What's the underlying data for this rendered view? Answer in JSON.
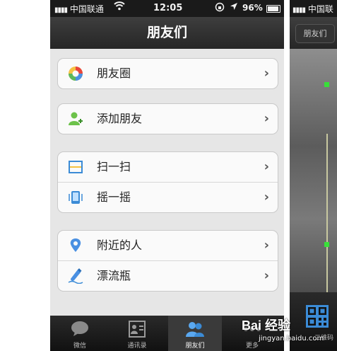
{
  "status_bar": {
    "carrier": "中国联通",
    "time": "12:05",
    "battery_percent": "96%"
  },
  "nav": {
    "title": "朋友们"
  },
  "groups": [
    [
      {
        "label": "朋友圈",
        "icon": "moments-icon"
      }
    ],
    [
      {
        "label": "添加朋友",
        "icon": "add-friend-icon"
      }
    ],
    [
      {
        "label": "扫一扫",
        "icon": "scan-icon"
      },
      {
        "label": "摇一摇",
        "icon": "shake-icon"
      }
    ],
    [
      {
        "label": "附近的人",
        "icon": "location-pin-icon"
      },
      {
        "label": "漂流瓶",
        "icon": "drift-bottle-icon"
      }
    ]
  ],
  "chevron": "›",
  "tabs": [
    {
      "label": "微信",
      "icon": "chat-bubble-icon"
    },
    {
      "label": "通讯录",
      "icon": "contacts-icon"
    },
    {
      "label": "朋友们",
      "icon": "friends-icon",
      "active": true
    },
    {
      "label": "更多",
      "icon": "more-icon"
    }
  ],
  "second_screen": {
    "carrier": "中国联通",
    "back_label": "朋友们",
    "tab_label": "二维码"
  },
  "watermark": {
    "brand": "Bai 经验",
    "url": "jingyan.baidu.com"
  },
  "colors": {
    "bar_dark": "#1a1a1a",
    "list_bg": "#e6e6e6",
    "corner_green": "#38e038"
  }
}
